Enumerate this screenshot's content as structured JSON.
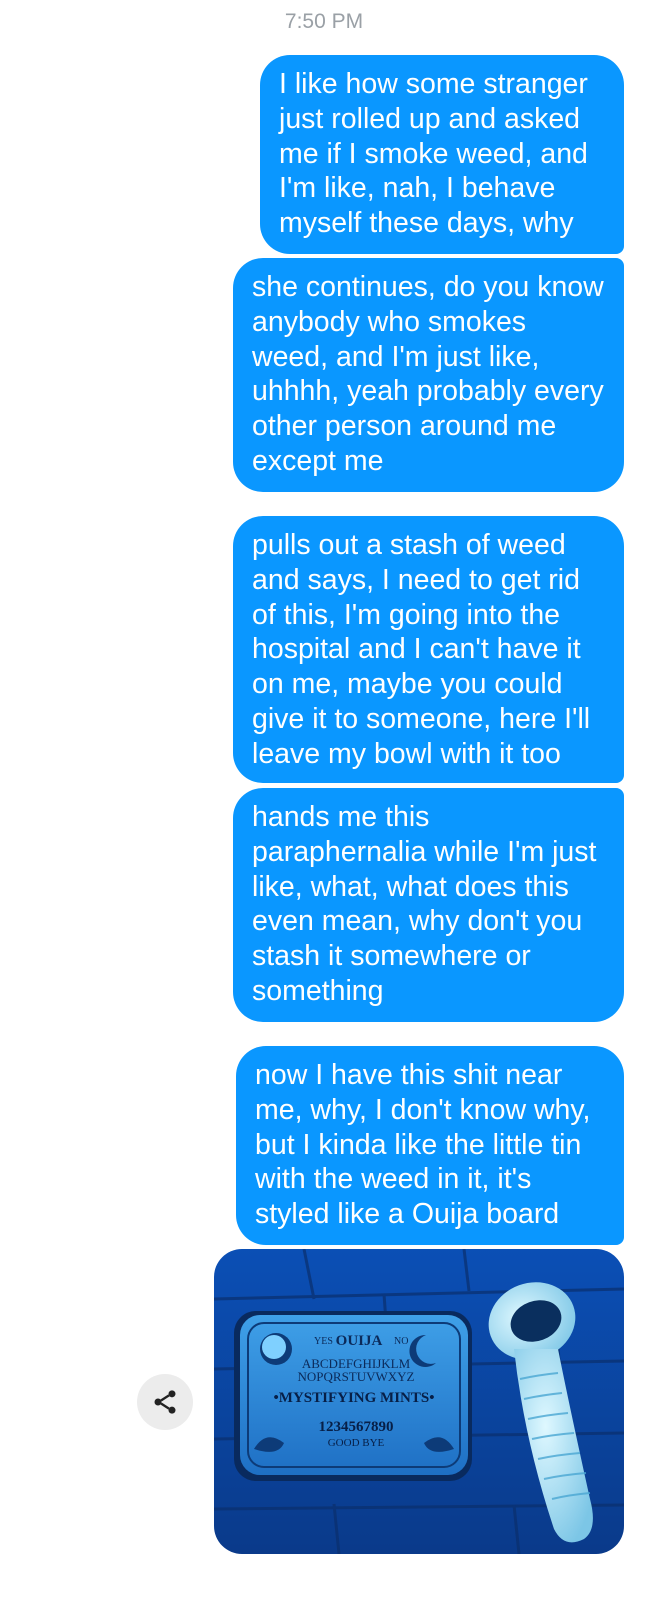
{
  "conversation": {
    "timestamp": "7:50 PM",
    "messages": [
      {
        "text": "I like how some stranger just rolled up and asked me if I smoke weed, and I'm like, nah, I behave myself these days, why"
      },
      {
        "text": "she continues, do you know anybody who smokes weed, and I'm just like, uhhhh, yeah probably every other person around me except me"
      },
      {
        "text": "pulls out a stash of weed and says, I need to get rid of this, I'm going into the hospital and I can't have it on me, maybe you could give it to someone, here I'll leave my bowl with it too"
      },
      {
        "text": "hands me this paraphernalia while I'm just like, what, what does this even mean, why don't you stash it somewhere or something"
      },
      {
        "text": "now I have this shit near me, why, I don't know why, but I kinda like the little tin with the weed in it, it's styled like a Ouija board"
      }
    ],
    "photo": {
      "tin_brand": "OUIJA",
      "tin_yes": "YES",
      "tin_no": "NO",
      "tin_letters_row1": "ABCDEFGHIJKLM",
      "tin_letters_row2": "NOPQRSTUVWXYZ",
      "tin_title": "•MYSTIFYING MINTS•",
      "tin_numbers": "1234567890",
      "tin_goodbye": "GOOD BYE"
    },
    "share_icon": "share-icon"
  },
  "colors": {
    "bubble": "#0a97ff",
    "bubble_text": "#ffffff",
    "timestamp_text": "#9aa0a6",
    "share_button_bg": "#ececec"
  }
}
